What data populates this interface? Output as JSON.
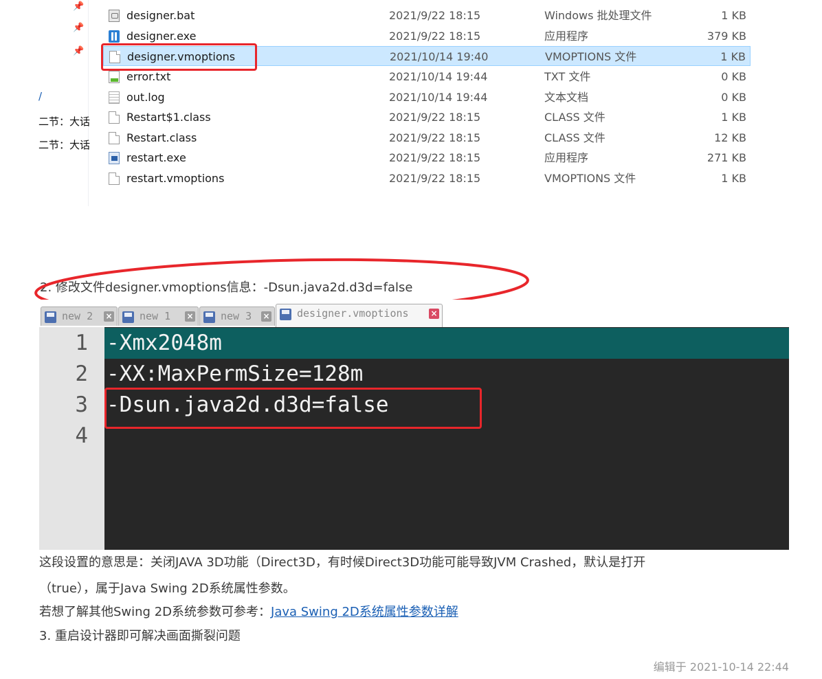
{
  "explorer": {
    "nav": {
      "link_fragment": "/",
      "items": [
        "二节：大话",
        "二节：大话"
      ]
    },
    "files": [
      {
        "name": "designer.bat",
        "date": "2021/9/22 18:15",
        "type": "Windows 批处理文件",
        "size": "1 KB",
        "icon": "batch-file-icon"
      },
      {
        "name": "designer.exe",
        "date": "2021/9/22 18:15",
        "type": "应用程序",
        "size": "379 KB",
        "icon": "exe-icon"
      },
      {
        "name": "designer.vmoptions",
        "date": "2021/10/14 19:40",
        "type": "VMOPTIONS 文件",
        "size": "1 KB",
        "icon": "document-icon",
        "selected": true
      },
      {
        "name": "error.txt",
        "date": "2021/10/14 19:44",
        "type": "TXT 文件",
        "size": "0 KB",
        "icon": "text-file-icon"
      },
      {
        "name": "out.log",
        "date": "2021/10/14 19:44",
        "type": "文本文档",
        "size": "0 KB",
        "icon": "log-file-icon"
      },
      {
        "name": "Restart$1.class",
        "date": "2021/9/22 18:15",
        "type": "CLASS 文件",
        "size": "1 KB",
        "icon": "document-icon"
      },
      {
        "name": "Restart.class",
        "date": "2021/9/22 18:15",
        "type": "CLASS 文件",
        "size": "12 KB",
        "icon": "document-icon"
      },
      {
        "name": "restart.exe",
        "date": "2021/9/22 18:15",
        "type": "应用程序",
        "size": "271 KB",
        "icon": "app-window-icon"
      },
      {
        "name": "restart.vmoptions",
        "date": "2021/9/22 18:15",
        "type": "VMOPTIONS 文件",
        "size": "1 KB",
        "icon": "document-icon"
      }
    ]
  },
  "article": {
    "step2": "2. 修改文件designer.vmoptions信息：-Dsun.java2d.d3d=false",
    "explain_line1": "这段设置的意思是：关闭JAVA 3D功能（Direct3D，有时候Direct3D功能可能导致JVM Crashed，默认是打开",
    "explain_line2": "（true），属于Java Swing 2D系统属性参数。",
    "ref_prefix": "若想了解其他Swing 2D系统参数可参考：",
    "ref_link": "Java Swing 2D系统属性参数详解",
    "step3": "3. 重启设计器即可解决画面撕裂问题",
    "edited": "编辑于 2021-10-14 22:44"
  },
  "editor": {
    "tabs": [
      {
        "label": "new 2",
        "close": "×"
      },
      {
        "label": "new 1",
        "close": "×"
      },
      {
        "label": "new 3",
        "close": "×"
      },
      {
        "label": "designer.vmoptions",
        "close": "×",
        "active": true
      }
    ],
    "line_numbers": [
      "1",
      "2",
      "3",
      "4"
    ],
    "lines": [
      "-Xmx2048m",
      "-XX:MaxPermSize=128m",
      "-Dsun.java2d.d3d=false",
      ""
    ]
  },
  "colors": {
    "highlight_red": "#e8262b",
    "selection": "#cce8ff",
    "current_line": "#0d5f5f",
    "editor_bg": "#272727",
    "link": "#1a5fb4"
  }
}
